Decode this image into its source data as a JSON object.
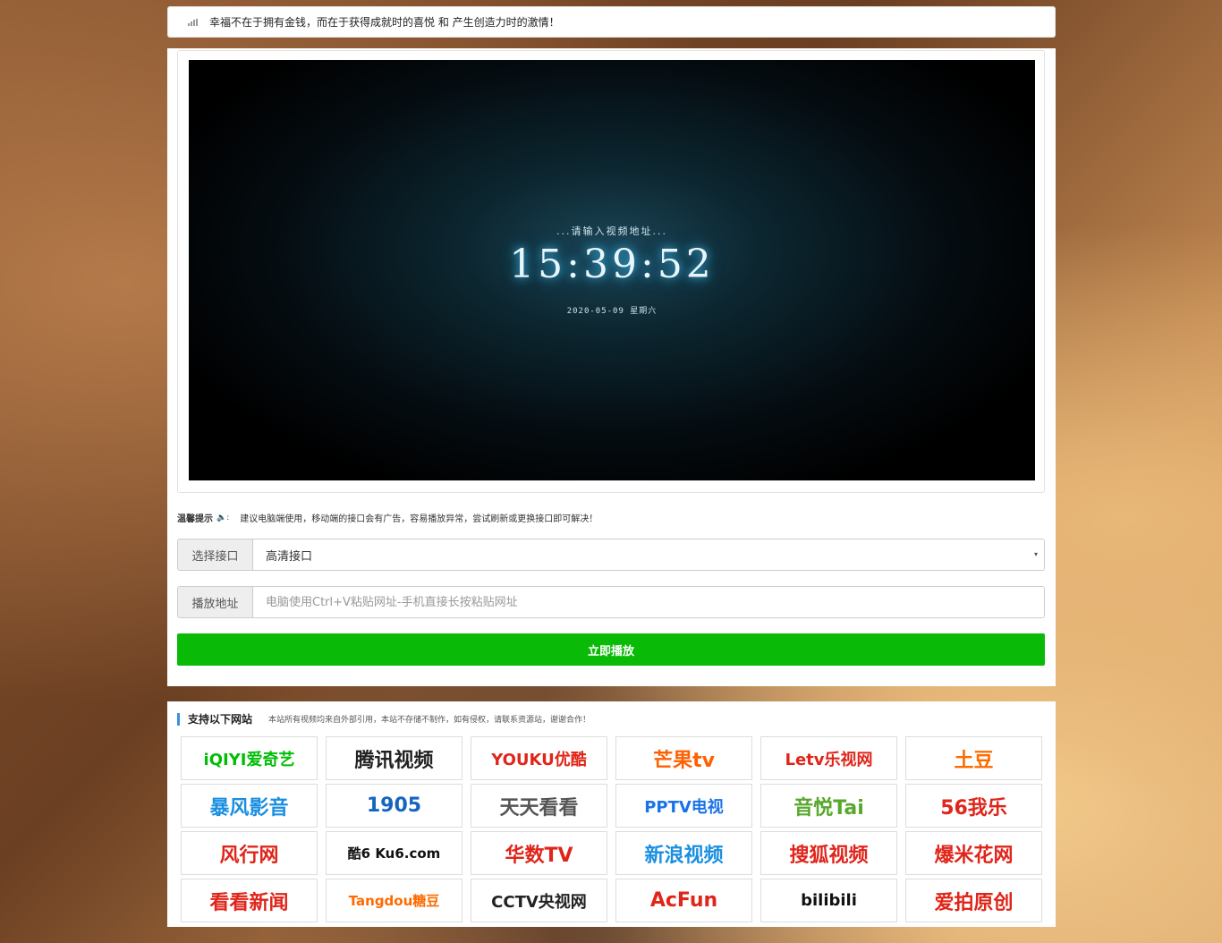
{
  "notice": {
    "text": "幸福不在于拥有金钱，而在于获得成就时的喜悦 和 产生创造力时的激情！",
    "icon": "signal-bars-icon"
  },
  "player": {
    "hint": "...请输入视频地址...",
    "time": "15:39:52",
    "date": "2020-05-09 星期六"
  },
  "tip": {
    "label": "温馨提示",
    "icon": "speaker-icon",
    "text": "建议电脑端使用，移动端的接口会有广告，容易播放异常，尝试刷新或更换接口即可解决！"
  },
  "interface_select": {
    "label": "选择接口",
    "value": "高清接口"
  },
  "url_input": {
    "label": "播放地址",
    "placeholder": "电脑使用Ctrl+V粘贴网址-手机直接长按粘贴网址"
  },
  "play_button": {
    "label": "立即播放",
    "color": "#09bb07"
  },
  "sites": {
    "title": "支持以下网站",
    "note": "本站所有视频均来自外部引用，本站不存储不制作，如有侵权，请联系资源站，谢谢合作！",
    "logos": [
      {
        "text": "iQIYI爱奇艺",
        "color": "#00be06"
      },
      {
        "text": "腾讯视频",
        "color": "#222222"
      },
      {
        "text": "YOUKU优酷",
        "color": "#e0251a"
      },
      {
        "text": "芒果tv",
        "color": "#ff5f00"
      },
      {
        "text": "Letv乐视网",
        "color": "#e0251a"
      },
      {
        "text": "土豆",
        "color": "#ff6a00"
      },
      {
        "text": "暴风影音",
        "color": "#1a8fe0"
      },
      {
        "text": "1905",
        "color": "#1565c0"
      },
      {
        "text": "天天看看",
        "color": "#555555"
      },
      {
        "text": "PPTV电视",
        "color": "#1a73e8"
      },
      {
        "text": "音悦Tai",
        "color": "#58a82c"
      },
      {
        "text": "56我乐",
        "color": "#e0251a"
      },
      {
        "text": "风行网",
        "color": "#e0251a"
      },
      {
        "text": "酷6 Ku6.com",
        "color": "#111111"
      },
      {
        "text": "华数TV",
        "color": "#e0251a"
      },
      {
        "text": "新浪视频",
        "color": "#1a8fe0"
      },
      {
        "text": "搜狐视频",
        "color": "#e0251a"
      },
      {
        "text": "爆米花网",
        "color": "#e0251a"
      },
      {
        "text": "看看新闻",
        "color": "#e0251a"
      },
      {
        "text": "Tangdou糖豆",
        "color": "#ff6a00"
      },
      {
        "text": "CCTV央视网",
        "color": "#222222"
      },
      {
        "text": "AcFun",
        "color": "#e0251a"
      },
      {
        "text": "bilibili",
        "color": "#111111"
      },
      {
        "text": "爱拍原创",
        "color": "#e0251a"
      }
    ]
  }
}
